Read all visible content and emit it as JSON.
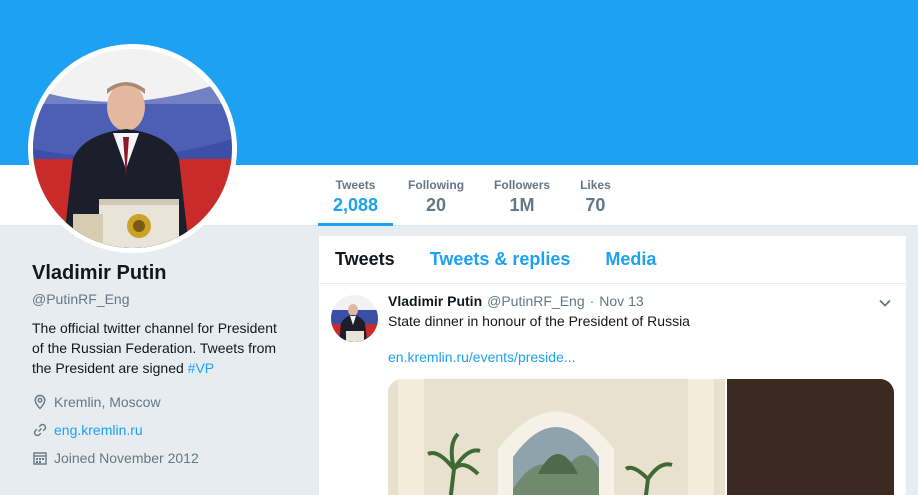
{
  "profile": {
    "name": "Vladimir Putin",
    "handle": "@PutinRF_Eng",
    "bio_text": "The official twitter channel for President of the Russian Federation. Tweets from the President are signed ",
    "bio_hashtag": "#VP",
    "location": "Kremlin, Moscow",
    "website": "eng.kremlin.ru",
    "joined": "Joined November 2012"
  },
  "stats": [
    {
      "label": "Tweets",
      "value": "2,088"
    },
    {
      "label": "Following",
      "value": "20"
    },
    {
      "label": "Followers",
      "value": "1M"
    },
    {
      "label": "Likes",
      "value": "70"
    }
  ],
  "timeline": {
    "tabs": [
      "Tweets",
      "Tweets & replies",
      "Media"
    ],
    "tweet": {
      "name": "Vladimir Putin",
      "handle": "@PutinRF_Eng",
      "separator": "·",
      "date": "Nov 13",
      "text": "State dinner in honour of the President of Russia",
      "link": "en.kremlin.ru/events/preside..."
    }
  },
  "colors": {
    "accent": "#1da1f2",
    "banner": "#1da1f2",
    "muted": "#657786",
    "background": "#e6ecf0"
  },
  "icons": {
    "location": "map-pin-icon",
    "website": "link-icon",
    "joined": "calendar-icon",
    "tweet_menu": "chevron-down-icon"
  }
}
